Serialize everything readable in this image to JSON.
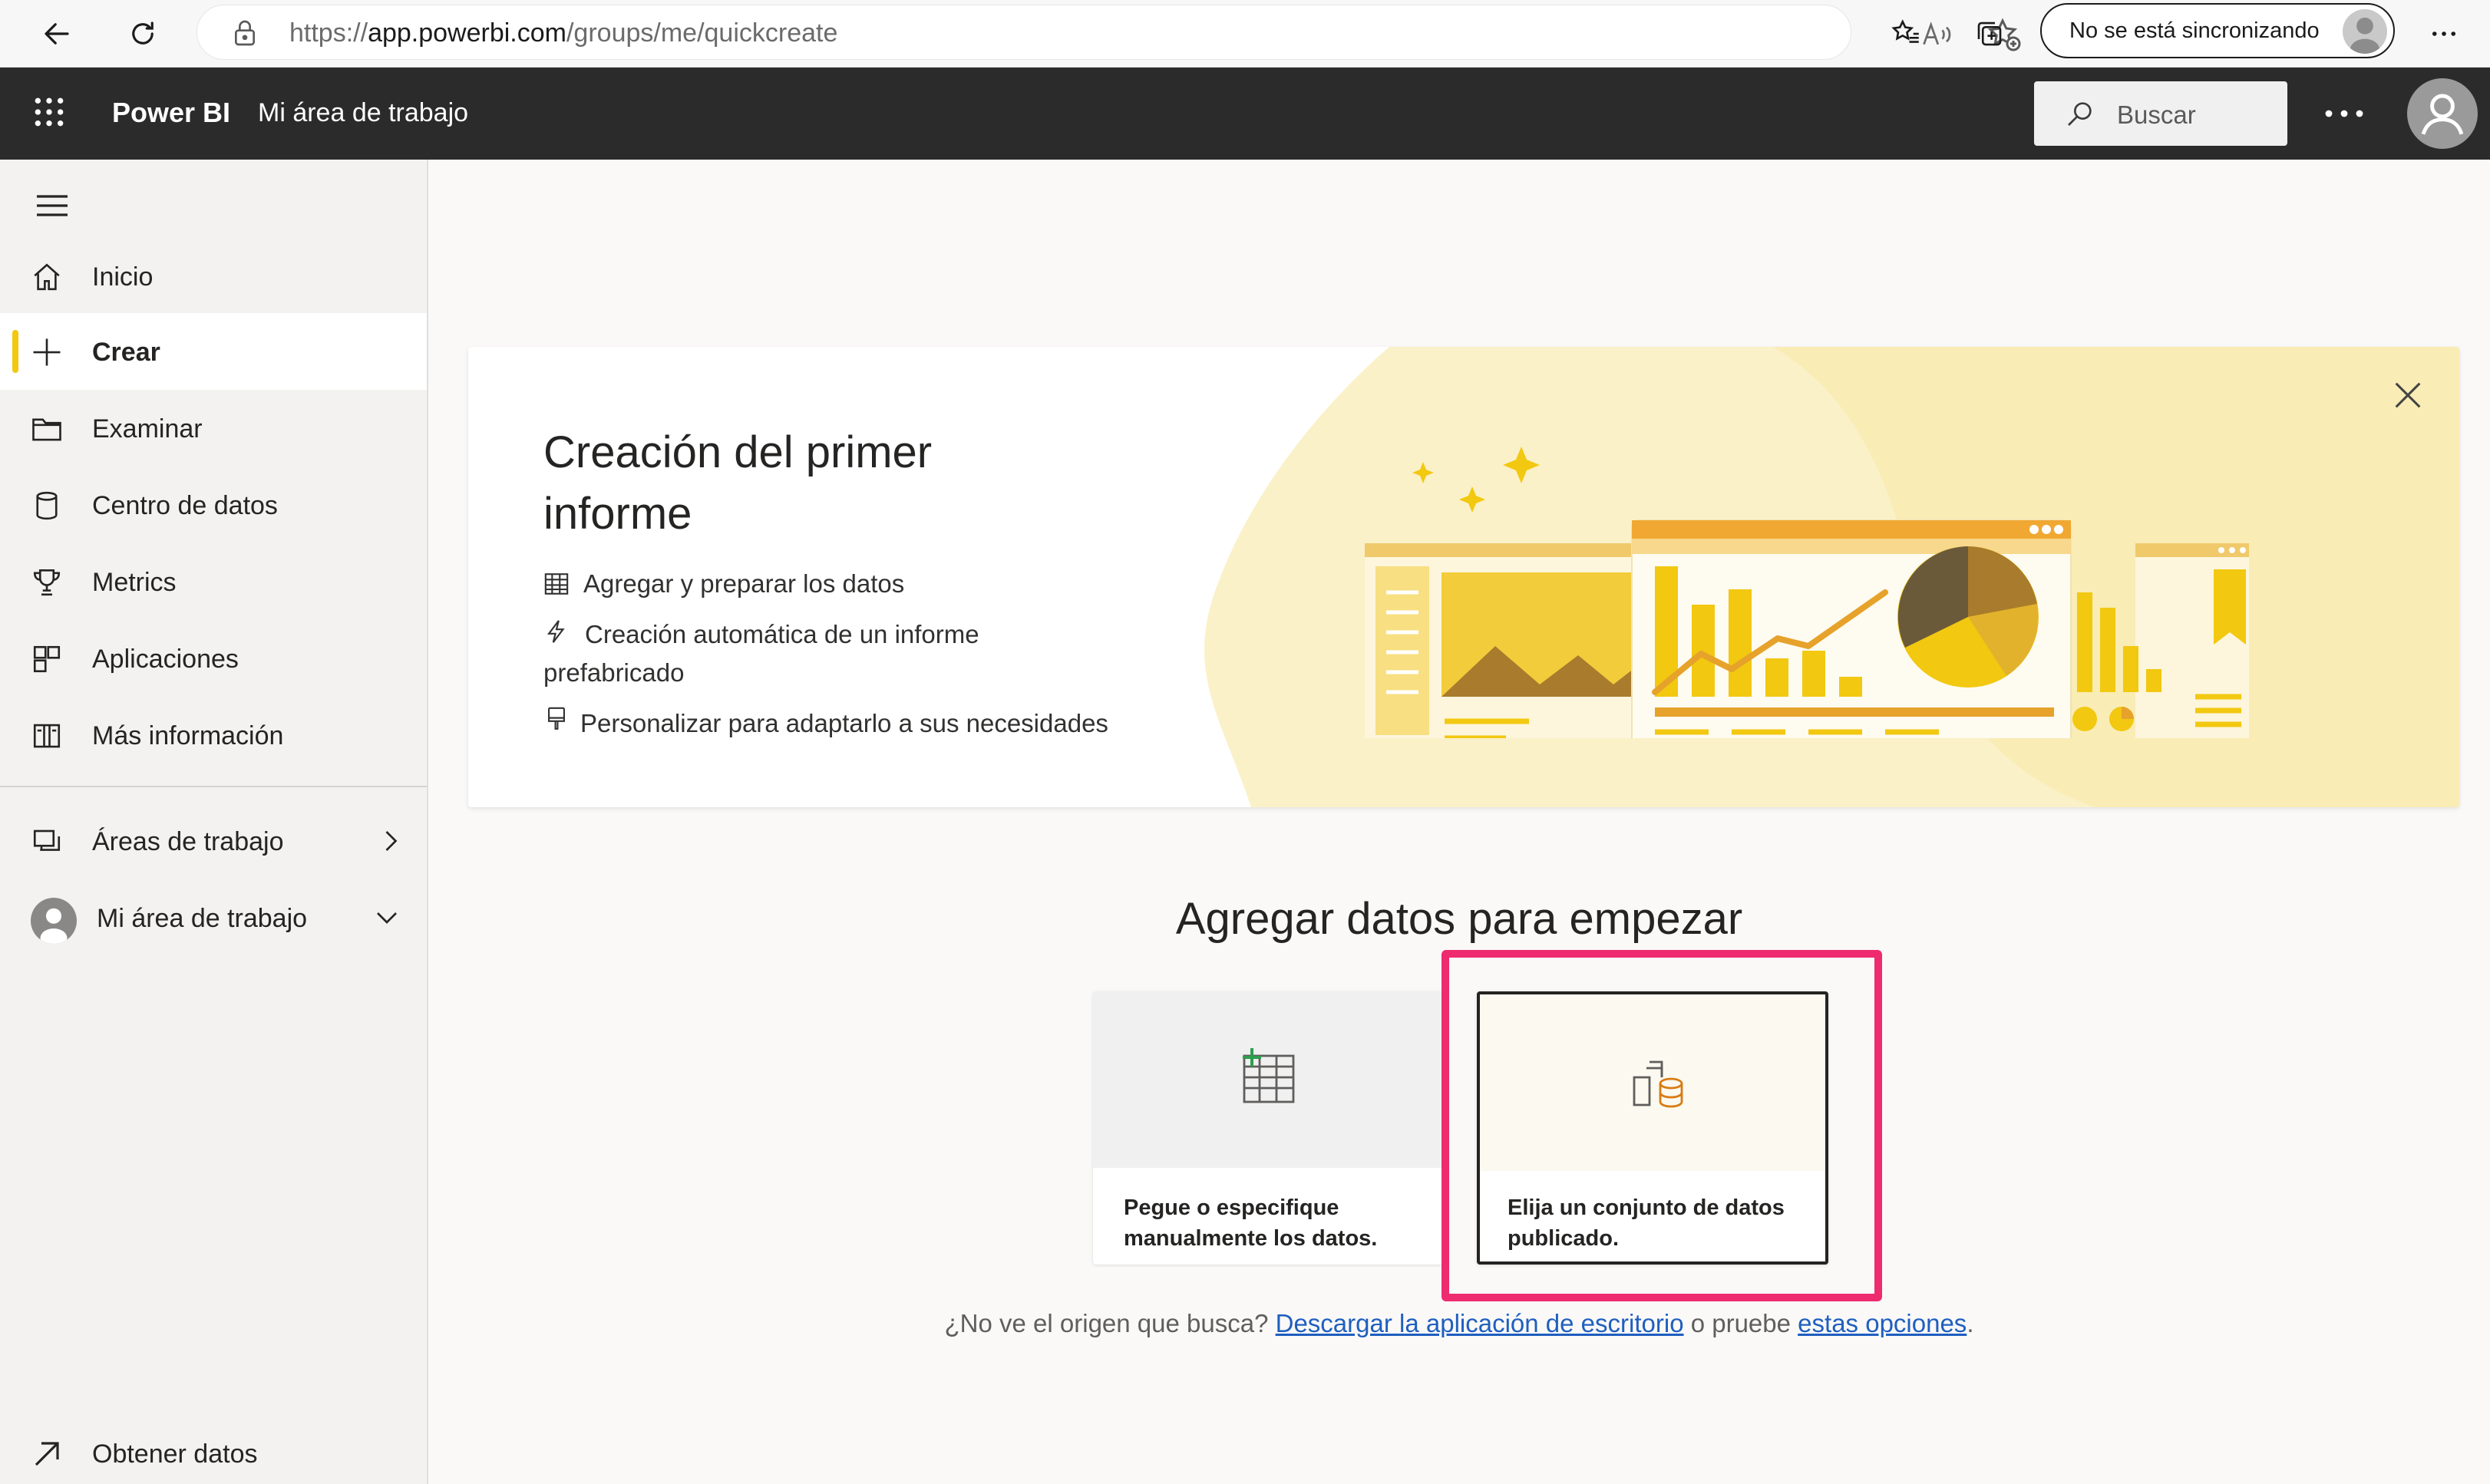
{
  "browser": {
    "url_prefix": "https://",
    "url_host": "app.powerbi.com",
    "url_path": "/groups/me/quickcreate",
    "sync_label": "No se está sincronizando"
  },
  "header": {
    "brand": "Power BI",
    "workspace": "Mi área de trabajo",
    "search_label": "Buscar"
  },
  "sidebar": {
    "items": [
      {
        "label": "Inicio",
        "icon": "home-icon"
      },
      {
        "label": "Crear",
        "icon": "plus-icon",
        "active": true
      },
      {
        "label": "Examinar",
        "icon": "folder-icon"
      },
      {
        "label": "Centro de datos",
        "icon": "database-icon"
      },
      {
        "label": "Metrics",
        "icon": "trophy-icon"
      },
      {
        "label": "Aplicaciones",
        "icon": "apps-icon"
      },
      {
        "label": "Más información",
        "icon": "book-icon"
      }
    ],
    "workspaces_label": "Áreas de trabajo",
    "my_workspace_label": "Mi área de trabajo",
    "get_data_label": "Obtener datos"
  },
  "banner": {
    "title": "Creación del primer informe",
    "features": [
      {
        "text": "Agregar y preparar los datos",
        "icon": "table-icon"
      },
      {
        "text": "Creación automática de un informe prefabricado",
        "icon": "lightning-icon"
      },
      {
        "text": "Personalizar para adaptarlo a sus necesidades",
        "icon": "paintbrush-icon"
      }
    ]
  },
  "main": {
    "section_title": "Agregar datos para empezar",
    "cards": [
      {
        "label": "Pegue o especifique manualmente los datos.",
        "icon": "table-add-icon"
      },
      {
        "label": "Elija un conjunto de datos publicado.",
        "icon": "dataset-icon",
        "selected": true
      }
    ],
    "footer": {
      "prefix": "¿No ve el origen que busca?",
      "link1": "Descargar la aplicación de escritorio",
      "middle": "o pruebe",
      "link2": "estas opciones",
      "suffix": "."
    }
  },
  "colors": {
    "header_bg": "#2b2b2b",
    "accent_yellow": "#f2c811",
    "highlight_pink": "#ee2b6f",
    "link_blue": "#1f5fbf"
  }
}
